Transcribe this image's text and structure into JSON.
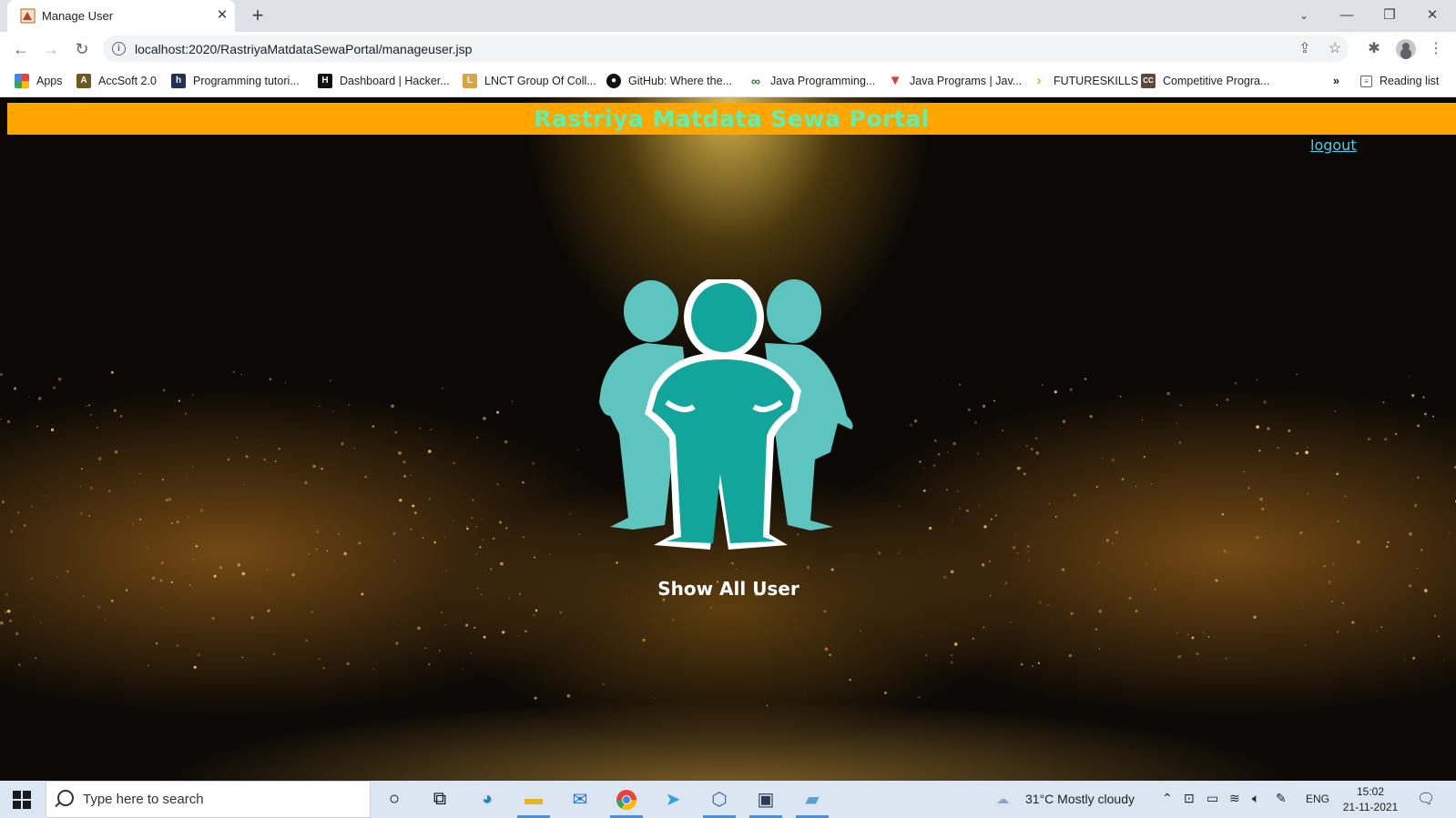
{
  "browser": {
    "tab_title": "Manage User",
    "url": "localhost:2020/RastriyaMatdataSewaPortal/manageuser.jsp",
    "bookmarks": [
      {
        "label": "Apps"
      },
      {
        "label": "AccSoft 2.0"
      },
      {
        "label": "Programming tutori..."
      },
      {
        "label": "Dashboard | Hacker..."
      },
      {
        "label": "LNCT Group Of Coll..."
      },
      {
        "label": "GitHub: Where the..."
      },
      {
        "label": "Java Programming..."
      },
      {
        "label": "Java Programs | Jav..."
      },
      {
        "label": "FUTURESKILLS"
      },
      {
        "label": "Competitive Progra..."
      }
    ],
    "overflow": "»",
    "reading_list": "Reading list"
  },
  "page": {
    "banner_title": "Rastriya Matdata Sewa Portal",
    "logout_link": "logout",
    "show_all_user": "Show All User",
    "colors": {
      "banner_bg": "#ffa500",
      "banner_text": "#5ef0b0",
      "logout": "#3ad6f0",
      "users_teal": "#5ec4c0",
      "center_user_teal": "#12a59b"
    }
  },
  "taskbar": {
    "search_placeholder": "Type here to search",
    "weather": "31°C  Mostly cloudy",
    "language": "ENG",
    "time": "15:02",
    "date": "21-11-2021"
  }
}
